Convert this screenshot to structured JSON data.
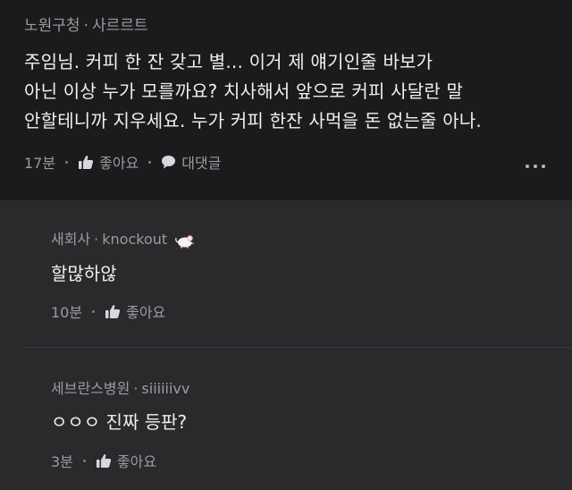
{
  "main_comment": {
    "company": "노원구청",
    "author": "사르르트",
    "lines": [
      "주임님. 커피 한 잔 갖고 별... 이거 제 얘기인줄 바보가",
      "아닌 이상 누가 모를까요? 치사해서 앞으로 커피 사달란 말",
      "안할테니까 지우세요. 누가 커피 한잔 사먹을 돈 없는줄 아나."
    ],
    "time": "17분",
    "like_label": "좋아요",
    "reply_label": "대댓글",
    "more_icon": "more-horizontal-icon"
  },
  "replies": [
    {
      "company": "새회사",
      "author": "knockout",
      "badge_icon": "mouse-icon",
      "text": "할많하않",
      "time": "10분",
      "like_label": "좋아요"
    },
    {
      "company": "세브란스병원",
      "author": "siiiiiivv",
      "text": "ㅇㅇㅇ 진짜 등판?",
      "time": "3분",
      "like_label": "좋아요"
    }
  ],
  "colors": {
    "background": "#1b1b1d",
    "reply_background": "#2a2a2d",
    "meta_text": "#9b9ba0",
    "body_text": "#efeff1"
  }
}
